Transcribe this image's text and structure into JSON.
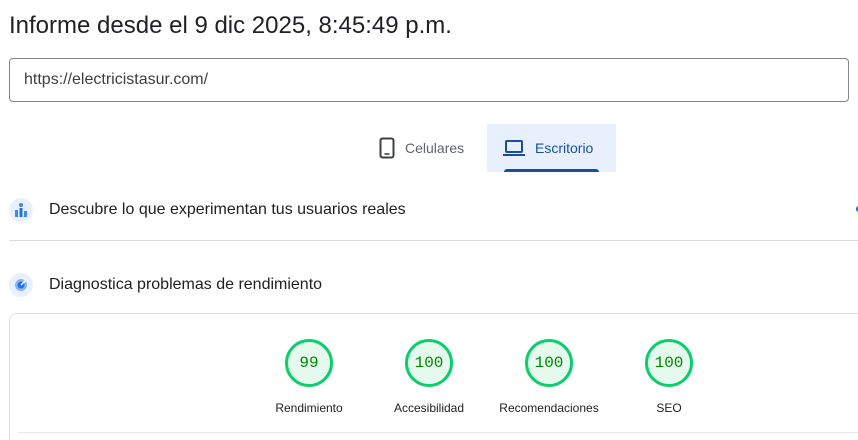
{
  "report": {
    "title": "Informe desde el 9 dic 2025, 8:45:49 p.m."
  },
  "url_input": {
    "value": "https://electricistasur.com/"
  },
  "device_tabs": [
    {
      "label": "Celulares",
      "icon": "smartphone-icon",
      "active": false
    },
    {
      "label": "Escritorio",
      "icon": "laptop-icon",
      "active": true
    }
  ],
  "sections": {
    "crux": {
      "label": "Descubre lo que experimentan tus usuarios reales",
      "icon": "users-chart-icon"
    },
    "diagnostics": {
      "label": "Diagnostica problemas de rendimiento",
      "icon": "lighthouse-icon"
    }
  },
  "scores": [
    {
      "value": "99",
      "label": "Rendimiento",
      "fraction": 0.99
    },
    {
      "value": "100",
      "label": "Accesibilidad",
      "fraction": 1.0
    },
    {
      "value": "100",
      "label": "Recomendaciones",
      "fraction": 1.0
    },
    {
      "value": "100",
      "label": "SEO",
      "fraction": 1.0
    }
  ],
  "colors": {
    "accent": "#1a4fa0",
    "pass": "#0cce6b",
    "pass_text": "#008800",
    "pass_fill": "#e6f9ee"
  }
}
